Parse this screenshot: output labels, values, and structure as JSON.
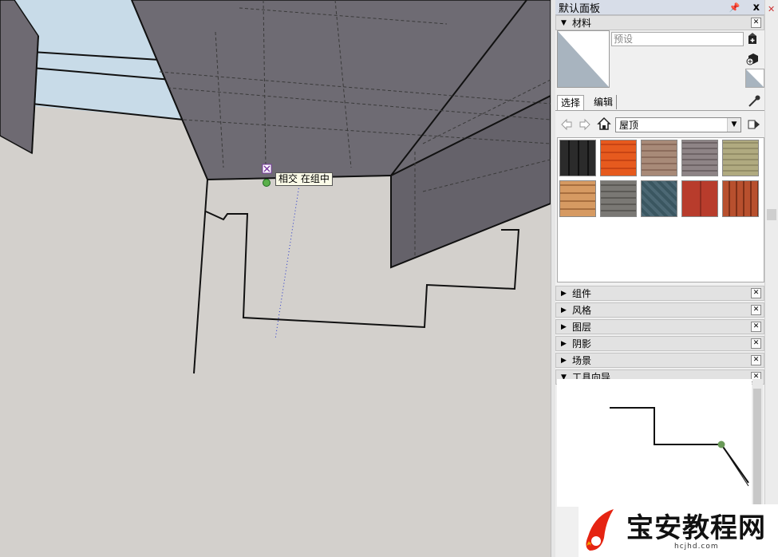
{
  "viewport": {
    "tooltip": "相交 在组中"
  },
  "panel": {
    "title": "默认面板",
    "pin_glyph": "📌",
    "close_glyph": "x",
    "materials": {
      "header": "材料",
      "name_placeholder": "预设",
      "tabs": [
        "选择",
        "编辑"
      ],
      "collection": "屋顶",
      "textures": [
        "roof-texture-1",
        "roof-texture-2",
        "roof-texture-3",
        "roof-texture-4",
        "roof-texture-5",
        "roof-texture-6",
        "roof-texture-7",
        "roof-texture-8",
        "roof-texture-9",
        "roof-texture-10"
      ]
    },
    "trays": [
      "组件",
      "风格",
      "图层",
      "阴影",
      "场景",
      "工具向导"
    ]
  },
  "watermark": {
    "title": "宝安教程网",
    "url": "hcjhd.com"
  }
}
